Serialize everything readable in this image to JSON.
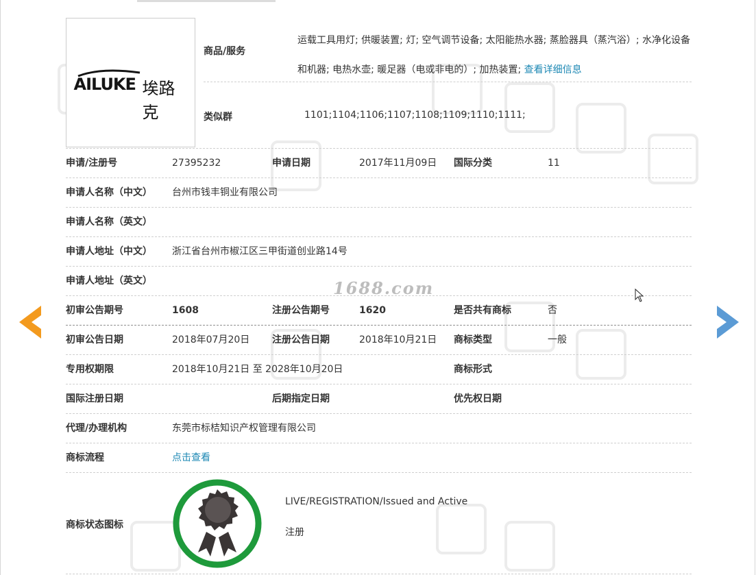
{
  "watermark_text": "1688.com",
  "logo": {
    "latin": "AILUKE",
    "chinese": "埃路克"
  },
  "goods": {
    "label": "商品/服务",
    "text": "运载工具用灯; 供暖装置; 灯; 空气调节设备; 太阳能热水器; 蒸脸器具（蒸汽浴）; 水净化设备和机器; 电热水壶; 暖足器（电或非电的）; 加热装置; ",
    "more_link": "查看详细信息"
  },
  "similar_group": {
    "label": "类似群",
    "value": "1101;1104;1106;1107;1108;1109;1110;1111;"
  },
  "rows": {
    "reg_no_label": "申请/注册号",
    "reg_no": "27395232",
    "app_date_label": "申请日期",
    "app_date": "2017年11月09日",
    "intl_class_label": "国际分类",
    "intl_class": "11",
    "applicant_cn_label": "申请人名称（中文）",
    "applicant_cn": "台州市钱丰铜业有限公司",
    "applicant_en_label": "申请人名称（英文）",
    "address_cn_label": "申请人地址（中文）",
    "address_cn": "浙江省台州市椒江区三甲街道创业路14号",
    "address_en_label": "申请人地址（英文）",
    "prelim_issue_label": "初审公告期号",
    "prelim_issue": "1608",
    "reg_issue_label": "注册公告期号",
    "reg_issue": "1620",
    "shared_label": "是否共有商标",
    "shared": "否",
    "prelim_date_label": "初审公告日期",
    "prelim_date": "2018年07月20日",
    "reg_date_label": "注册公告日期",
    "reg_date": "2018年10月21日",
    "tm_type_label": "商标类型",
    "tm_type": "一般",
    "excl_period_label": "专用权期限",
    "excl_period": "2018年10月21日 至 2028年10月20日",
    "tm_form_label": "商标形式",
    "intl_reg_date_label": "国际注册日期",
    "later_desig_label": "后期指定日期",
    "priority_label": "优先权日期",
    "agent_label": "代理/办理机构",
    "agent": "东莞市标桔知识产权管理有限公司",
    "flow_label": "商标流程",
    "flow_link": "点击查看"
  },
  "status": {
    "label": "商标状态图标",
    "english": "LIVE/REGISTRATION/Issued and Active",
    "chinese": "注册"
  },
  "colors": {
    "accent_link": "#1d88b4",
    "prev_arrow": "#f39a1e",
    "next_arrow": "#5b9bd5",
    "badge_ring": "#1e9a3b"
  }
}
